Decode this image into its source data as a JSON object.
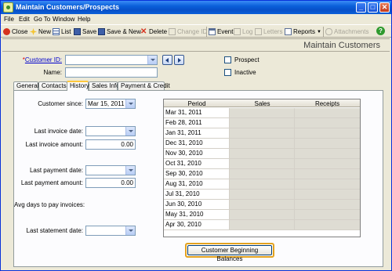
{
  "window": {
    "title": "Maintain Customers/Prospects",
    "btn_min": "_",
    "btn_max": "□",
    "btn_close": "✕"
  },
  "menu": [
    "File",
    "Edit",
    "Go To",
    "Window",
    "Help"
  ],
  "toolbar": {
    "close": "Close",
    "new": "New",
    "list": "List",
    "save": "Save",
    "save_new": "Save & New",
    "delete": "Delete",
    "change_id": "Change ID",
    "event": "Event",
    "log": "Log",
    "letters": "Letters",
    "reports": "Reports",
    "attachments": "Attachments",
    "help": "?"
  },
  "form": {
    "title": "Maintain Customers",
    "customer_id_label": "Customer ID:",
    "required_marker": "*",
    "customer_id_value": "",
    "name_label": "Name:",
    "name_value": "",
    "prospect_label": "Prospect",
    "inactive_label": "Inactive"
  },
  "tabs": [
    "General",
    "Contacts",
    "History",
    "Sales Info",
    "Payment & Credit"
  ],
  "active_tab": "History",
  "history": {
    "customer_since_label": "Customer since:",
    "customer_since_value": "Mar 15, 2011",
    "last_invoice_date_label": "Last invoice date:",
    "last_invoice_date_value": "",
    "last_invoice_amount_label": "Last invoice amount:",
    "last_invoice_amount_value": "0.00",
    "last_payment_date_label": "Last payment date:",
    "last_payment_date_value": "",
    "last_payment_amount_label": "Last payment amount:",
    "last_payment_amount_value": "0.00",
    "avg_days_label": "Avg days to pay invoices:",
    "last_statement_date_label": "Last statement date:",
    "last_statement_date_value": ""
  },
  "grid": {
    "columns": [
      "Period",
      "Sales",
      "Receipts"
    ],
    "rows": [
      {
        "period": "Mar 31, 2011",
        "sales": "",
        "receipts": ""
      },
      {
        "period": "Feb 28, 2011",
        "sales": "",
        "receipts": ""
      },
      {
        "period": "Jan 31, 2011",
        "sales": "",
        "receipts": ""
      },
      {
        "period": "Dec 31, 2010",
        "sales": "",
        "receipts": ""
      },
      {
        "period": "Nov 30, 2010",
        "sales": "",
        "receipts": ""
      },
      {
        "period": "Oct 31, 2010",
        "sales": "",
        "receipts": ""
      },
      {
        "period": "Sep 30, 2010",
        "sales": "",
        "receipts": ""
      },
      {
        "period": "Aug 31, 2010",
        "sales": "",
        "receipts": ""
      },
      {
        "period": "Jul 31, 2010",
        "sales": "",
        "receipts": ""
      },
      {
        "period": "Jun 30, 2010",
        "sales": "",
        "receipts": ""
      },
      {
        "period": "May 31, 2010",
        "sales": "",
        "receipts": ""
      },
      {
        "period": "Apr 30, 2010",
        "sales": "",
        "receipts": ""
      }
    ]
  },
  "beginning_balances_button": "Customer Beginning Balances",
  "colors": {
    "title_bar": "#0a5fd9",
    "focus_border": "#e3a21f",
    "window_bg": "#ece9d8"
  }
}
